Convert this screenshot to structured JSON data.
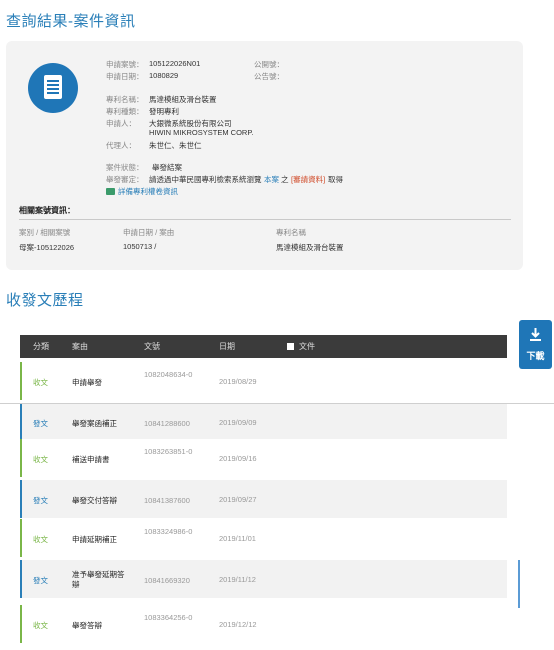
{
  "header": {
    "title": "查詢結果-案件資訊"
  },
  "case_info": {
    "app_no_label": "申請案號：",
    "app_no": "105122026N01",
    "app_date_label": "申請日期：",
    "app_date": "1080829",
    "pub_no_label": "公開號：",
    "notice_no_label": "公告號：",
    "patent_name_label": "專利名稱：",
    "patent_name": "馬達模組及滑台裝置",
    "patent_type_label": "專利種類：",
    "patent_type": "發明專利",
    "applicant_label": "申請人：",
    "applicant_zh": "大銀微系統股份有限公司",
    "applicant_en": "HIWIN MIKROSYSTEM CORP.",
    "agent_label": "代理人：",
    "agent": "朱世仁、朱世仁",
    "status_label": "案件狀態：",
    "status": "舉發結案",
    "decision_label": "舉發審定：",
    "decision_text": "請透過中華民國專利檢索系統瀏覽",
    "decision_link": "本案",
    "decision_mid": "之",
    "decision_tag": "[審請資料]",
    "decision_end": "取得",
    "related_link": "詳備專利權卷資訊"
  },
  "related": {
    "title": "相關案號資訊：",
    "headers": [
      "案別 / 相關案號",
      "申請日期 / 案由",
      "專利名稱"
    ],
    "row": [
      "母案-105122026",
      "1050713 /",
      "馬達模組及滑台裝置"
    ]
  },
  "history": {
    "title": "收發文歷程",
    "headers": {
      "category": "分類",
      "subject": "案由",
      "doc_no": "文號",
      "date": "日期",
      "file": "文件"
    },
    "rows": [
      {
        "category": "收文",
        "subject": "申請舉發",
        "doc_no": "1082048634-0",
        "date": "2019/08/29"
      },
      {
        "category": "發文",
        "subject": "舉發案函補正",
        "doc_no": "10841288600",
        "date": "2019/09/09"
      },
      {
        "category": "收文",
        "subject": "補送申請書",
        "doc_no": "1083263851-0",
        "date": "2019/09/16"
      },
      {
        "category": "發文",
        "subject": "舉發交付答辯",
        "doc_no": "10841387600",
        "date": "2019/09/27"
      },
      {
        "category": "收文",
        "subject": "申請延期補正",
        "doc_no": "1083324986-0",
        "date": "2019/11/01"
      },
      {
        "category": "發文",
        "subject": "准予舉發延期答辯",
        "doc_no": "10841669320",
        "date": "2019/11/12"
      },
      {
        "category": "收文",
        "subject": "舉發答辯",
        "doc_no": "1083364256-0",
        "date": "2019/12/12"
      }
    ]
  },
  "download": {
    "label": "下載"
  },
  "colors": {
    "accent": "#1f76b7",
    "received": "#7ab648",
    "sent": "#2a7fb8",
    "header_bg": "#3b3b3b"
  }
}
